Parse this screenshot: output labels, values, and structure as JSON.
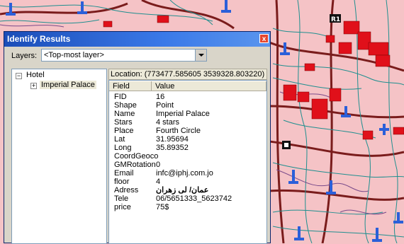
{
  "window": {
    "title": "Identify Results",
    "close_glyph": "x"
  },
  "layers": {
    "label": "Layers:",
    "selected": "<Top-most layer>"
  },
  "tree": {
    "root": {
      "expander": "−",
      "label": "Hotel"
    },
    "child": {
      "expander": "+",
      "label": "Imperial Palace"
    }
  },
  "location": "Location: (773477.585605  3539328.803220)",
  "grid": {
    "header_field": "Field",
    "header_value": "Value",
    "rows": [
      {
        "field": "FID",
        "value": "16"
      },
      {
        "field": "Shape",
        "value": "Point"
      },
      {
        "field": "Name",
        "value": "Imperial Palace"
      },
      {
        "field": "Stars",
        "value": "4 stars"
      },
      {
        "field": "Place",
        "value": "Fourth Circle"
      },
      {
        "field": "Lat",
        "value": "31.95694"
      },
      {
        "field": "Long",
        "value": "35.89352"
      },
      {
        "field": "CoordGeoco",
        "value": ""
      },
      {
        "field": "GMRotation",
        "value": "0"
      },
      {
        "field": "Email",
        "value": "infc@iphj.com.jo"
      },
      {
        "field": "floor",
        "value": "4"
      },
      {
        "field": "Adress",
        "value": "عمان/ لى زهران"
      },
      {
        "field": "Tele",
        "value": "06/5651333_5623742"
      },
      {
        "field": "price",
        "value": "75$"
      }
    ]
  },
  "map": {
    "background": "#f5c3c6",
    "road_color": "#7a1c1c",
    "street_color": "#1f8f8f",
    "building_color": "#e0101a",
    "pin_color": "#2b5fd9",
    "marker_label": "R1"
  },
  "icons": [
    "close-icon",
    "dropdown-arrow-icon",
    "tree-collapse-icon",
    "tree-expand-icon",
    "hotel-marker-icon",
    "pin-icon"
  ]
}
